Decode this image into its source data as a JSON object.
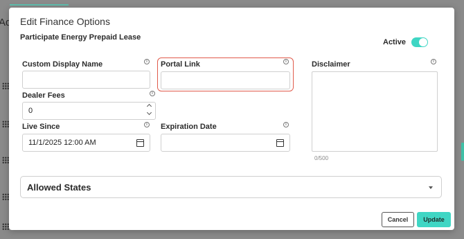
{
  "background": {
    "partial_heading": "Ad"
  },
  "modal": {
    "title": "Edit Finance Options",
    "subtitle": "Participate Energy Prepaid Lease",
    "active": {
      "label": "Active",
      "on": true
    },
    "fields": {
      "custom_display_name": {
        "label": "Custom Display Name",
        "value": "",
        "info_icon": "info-icon"
      },
      "portal_link": {
        "label": "Portal Link",
        "value": "",
        "info_icon": "info-icon"
      },
      "disclaimer": {
        "label": "Disclaimer",
        "value": "",
        "counter": "0/500",
        "info_icon": "info-icon"
      },
      "dealer_fees": {
        "label": "Dealer Fees",
        "value": "0",
        "info_icon": "info-icon"
      },
      "live_since": {
        "label": "Live Since",
        "value": "11/1/2025 12:00 AM",
        "info_icon": "info-icon"
      },
      "expiration_date": {
        "label": "Expiration Date",
        "value": "",
        "info_icon": "info-icon"
      }
    },
    "allowed_states": {
      "label": "Allowed States"
    },
    "buttons": {
      "cancel": "Cancel",
      "update": "Update"
    }
  },
  "colors": {
    "accent": "#3fd6c4",
    "focus_border": "#e05a4a",
    "overlay": "#8a8a8a"
  }
}
